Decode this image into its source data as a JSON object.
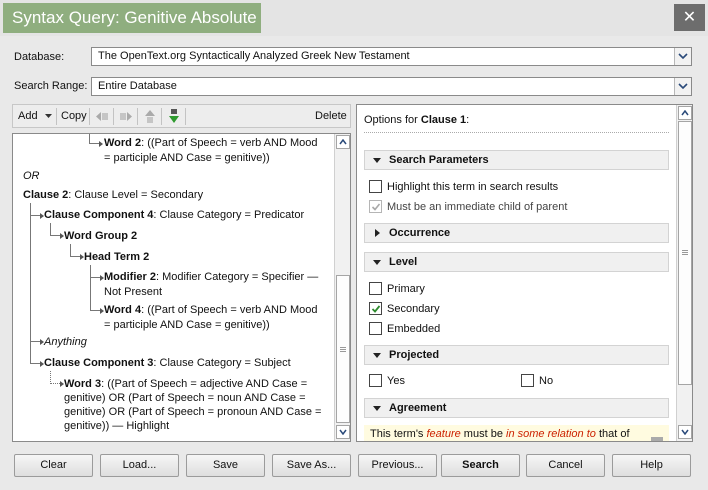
{
  "window": {
    "title": "Syntax Query: Genitive Absolute",
    "close_glyph": "✕"
  },
  "database": {
    "label": "Database:",
    "value": "The OpenText.org Syntactically Analyzed Greek New Testament"
  },
  "search_range": {
    "label": "Search Range:",
    "value": "Entire Database"
  },
  "toolbar": {
    "add": "Add",
    "copy": "Copy",
    "delete": "Delete"
  },
  "tree": {
    "word2_label": "Word 2",
    "word2_text": ": ((Part of Speech = verb AND Mood",
    "word2_text2": "= participle AND Case = genitive))",
    "or": "OR",
    "clause2_label": "Clause 2",
    "clause2_text": ": Clause Level = Secondary",
    "cc4_label": "Clause Component 4",
    "cc4_text": ": Clause Category = Predicator",
    "wg2_label": "Word Group 2",
    "ht2_label": "Head Term 2",
    "mod2_label": "Modifier 2",
    "mod2_text": ": Modifier Category = Specifier —",
    "mod2_text2": "Not Present",
    "word4_label": "Word 4",
    "word4_text": ": ((Part of Speech = verb AND Mood",
    "word4_text2": "= participle AND Case = genitive))",
    "anything": "Anything",
    "cc3_label": "Clause Component 3",
    "cc3_text": ": Clause Category = Subject",
    "word3_label": "Word 3",
    "word3_text": ": ((Part of Speech = adjective AND Case =",
    "word3_text2": "genitive) OR (Part of Speech = noun AND Case =",
    "word3_text3": "genitive) OR (Part of Speech = pronoun AND Case =",
    "word3_text4": "genitive)) — Highlight"
  },
  "options": {
    "header_prefix": "Options for",
    "header_target": "Clause 1",
    "header_suffix": ":",
    "search_params": {
      "title": "Search Parameters",
      "highlight": "Highlight this term in search results",
      "immediate_child": "Must be an immediate child of parent"
    },
    "occurrence": {
      "title": "Occurrence"
    },
    "level": {
      "title": "Level",
      "primary": "Primary",
      "secondary": "Secondary",
      "embedded": "Embedded"
    },
    "projected": {
      "title": "Projected",
      "yes": "Yes",
      "no": "No"
    },
    "agreement": {
      "title": "Agreement",
      "text_a": "This term's ",
      "feature": "feature",
      "text_b": " must be ",
      "relation": "in some relation to",
      "text_c": " that of"
    }
  },
  "buttons": {
    "clear": "Clear",
    "load": "Load...",
    "save": "Save",
    "save_as": "Save As...",
    "previous": "Previous...",
    "search": "Search",
    "cancel": "Cancel",
    "help": "Help"
  },
  "colors": {
    "title_green": "#8fae7f",
    "close_gray": "#6d6d6d",
    "check_green": "#2e8b2e",
    "agreement_red": "#cc2200"
  }
}
